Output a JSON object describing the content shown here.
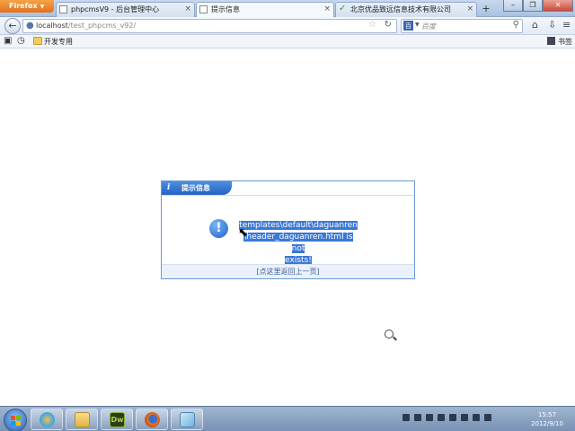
{
  "browser": {
    "menu_label": "Firefox",
    "tabs": [
      {
        "label": "phpcmsV9 - 后台管理中心",
        "active": false
      },
      {
        "label": "提示信息",
        "active": true
      },
      {
        "label": "北京优品致远信息技术有限公司",
        "active": false
      }
    ],
    "new_tab": "+",
    "url_host": "localhost",
    "url_path": "/test_phpcms_v92/",
    "search_engine_glyph": "百",
    "search_placeholder": "百度",
    "bookmark_folder": "开发专用",
    "bookmarks_label": "书签"
  },
  "dialog": {
    "title": "提示信息",
    "message_lines": [
      "templates\\default\\daguanren",
      "\\header_daguanren.html is not",
      "exists!"
    ],
    "back_link": "[点这里返回上一页]"
  },
  "taskbar": {
    "dw_label": "Dw",
    "time": "15:57",
    "date": "2012/9/10"
  },
  "colors": {
    "dialog_header": "#2463c4",
    "selection": "#3a78d6",
    "taskbar": "#7991b3"
  }
}
